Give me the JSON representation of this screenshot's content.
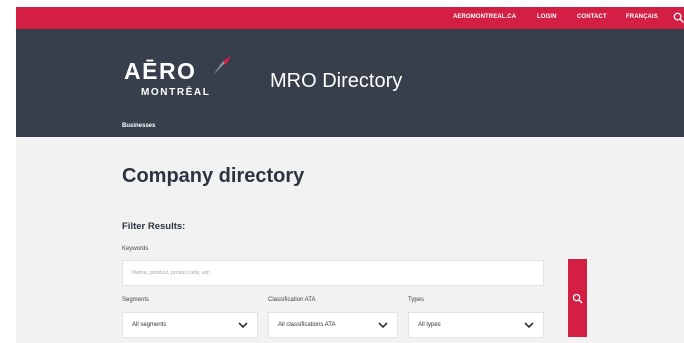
{
  "topbar": {
    "links": [
      "AEROMONTREAL.CA",
      "LOGIN",
      "CONTACT",
      "FRANÇAIS"
    ],
    "search_icon": "search-icon"
  },
  "header": {
    "logo_top": "AĒRO",
    "logo_bottom": "MONTRĒAL",
    "title": "MRO Directory",
    "nav_item": "Businesses"
  },
  "main": {
    "page_title": "Company directory",
    "filter_title": "Filter Results:",
    "keywords_label": "Keywords",
    "keywords_placeholder": "Name, product, postal code, etc.",
    "segments_label": "Segments",
    "segments_value": "All segments",
    "classification_label": "Classification ATA",
    "classification_value": "All classifications ATA",
    "types_label": "Types",
    "types_value": "All types"
  },
  "colors": {
    "brand_red": "#d41f45",
    "header_bg": "#363f4b",
    "page_bg": "#f2f2f2"
  }
}
